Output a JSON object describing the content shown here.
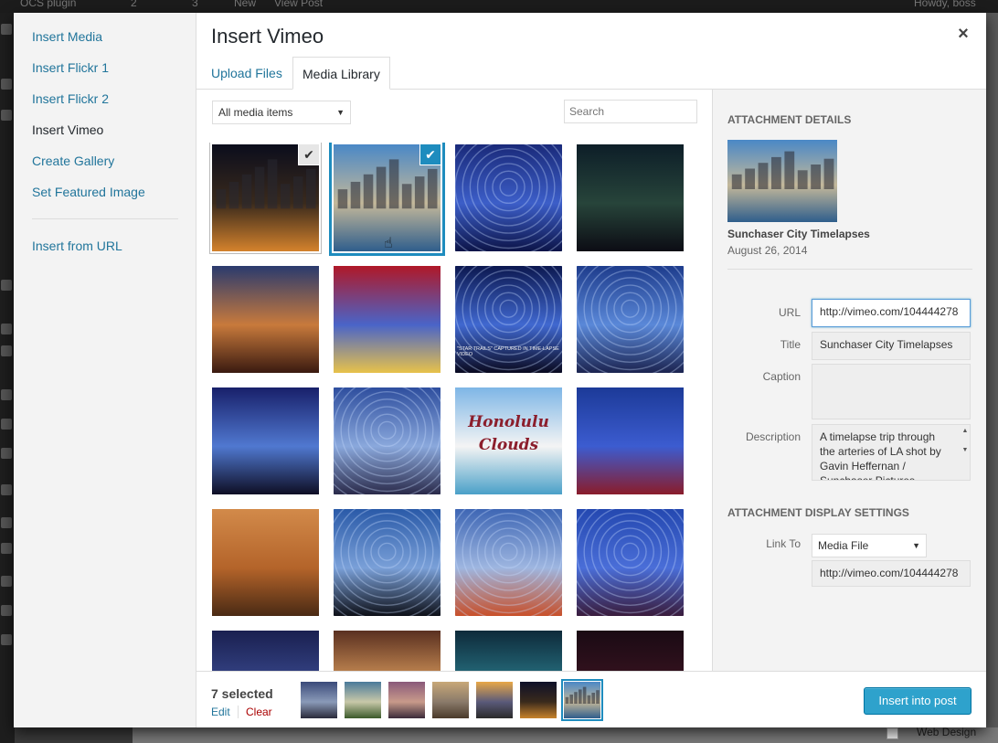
{
  "admin_bar": {
    "site": "OCS plugin",
    "updates": "2",
    "comments": "3",
    "new": "New",
    "view_post": "View Post",
    "howdy": "Howdy, boss"
  },
  "backdrop": {
    "category_label": "Web Design"
  },
  "menu": {
    "items": [
      {
        "label": "Insert Media"
      },
      {
        "label": "Insert Flickr 1"
      },
      {
        "label": "Insert Flickr 2"
      },
      {
        "label": "Insert Vimeo"
      },
      {
        "label": "Create Gallery"
      },
      {
        "label": "Set Featured Image"
      },
      {
        "label": "Insert from URL"
      }
    ],
    "active": "Insert Vimeo"
  },
  "modal": {
    "title": "Insert Vimeo",
    "close_icon": "×"
  },
  "tabs": [
    {
      "label": "Upload Files"
    },
    {
      "label": "Media Library"
    }
  ],
  "filters": {
    "type_selected": "All media items",
    "search_placeholder": "Search"
  },
  "thumbnails": [
    {
      "theme": "city night",
      "colors": [
        "#0b0d1c",
        "#3a2a1c",
        "#d4822c"
      ],
      "checked": true
    },
    {
      "theme": "city skyline",
      "colors": [
        "#4a88c6",
        "#c4b89a",
        "#2f5e8c"
      ],
      "checked": true,
      "focused": true
    },
    {
      "theme": "star trails",
      "colors": [
        "#1a2a7a",
        "#3c5ec8",
        "#0c1448"
      ]
    },
    {
      "theme": "canyon night",
      "colors": [
        "#0d1e28",
        "#27443a",
        "#0c0c14"
      ]
    },
    {
      "theme": "milky way desert",
      "colors": [
        "#2a3a6e",
        "#c87a3c",
        "#3a1a10"
      ]
    },
    {
      "theme": "lights",
      "colors": [
        "#b01828",
        "#4a64c8",
        "#e8c24a"
      ]
    },
    {
      "theme": "star trails video",
      "colors": [
        "#0c1850",
        "#4068d0",
        "#0a0a20"
      ],
      "caption": "\"STAR TRAILS\" CAPTURED IN TIME-LAPSE VIDEO"
    },
    {
      "theme": "circle trails",
      "colors": [
        "#1e3c8c",
        "#5a88d8",
        "#1c2450"
      ]
    },
    {
      "theme": "branches",
      "colors": [
        "#18206a",
        "#5078d0",
        "#0e0e24"
      ]
    },
    {
      "theme": "trails",
      "colors": [
        "#2e4e9e",
        "#8aa8dc",
        "#2a2a4a"
      ]
    },
    {
      "theme": "clouds",
      "colors": [
        "#7eb6e6",
        "#f4f4f4",
        "#4aa0c8"
      ],
      "text": "Honolulu Clouds"
    },
    {
      "theme": "dragon",
      "colors": [
        "#1c3a98",
        "#3c5cd0",
        "#8a1c2a"
      ]
    },
    {
      "theme": "beach",
      "colors": [
        "#d28a4a",
        "#b4642a",
        "#4a2a14"
      ]
    },
    {
      "theme": "car trails",
      "colors": [
        "#2a5aa8",
        "#7aa0d8",
        "#0e1018"
      ]
    },
    {
      "theme": "desert trails",
      "colors": [
        "#3e66b4",
        "#9eb6e0",
        "#c8502a"
      ]
    },
    {
      "theme": "person trails",
      "colors": [
        "#2448b0",
        "#4a6ed8",
        "#3a1c3c"
      ]
    },
    {
      "theme": "night sky",
      "colors": [
        "#1a2050",
        "#3a4a90",
        "#0e1030"
      ]
    },
    {
      "theme": "tunnel",
      "colors": [
        "#5a3020",
        "#e0a060",
        "#2a1a14"
      ]
    },
    {
      "theme": "aurora",
      "colors": [
        "#0e2a3a",
        "#2a7a8a",
        "#0a1420"
      ]
    },
    {
      "theme": "eclipse",
      "colors": [
        "#1a0a14",
        "#3a1420",
        "#7a2a3a"
      ]
    }
  ],
  "details": {
    "heading": "ATTACHMENT DETAILS",
    "filename": "Sunchaser City Timelapses",
    "date": "August 26, 2014",
    "url_label": "URL",
    "url_value": "http://vimeo.com/104444278",
    "title_label": "Title",
    "title_value": "Sunchaser City Timelapses",
    "caption_label": "Caption",
    "caption_value": "",
    "description_label": "Description",
    "description_value": "A timelapse trip through the arteries of LA shot by Gavin Heffernan / Sunchaser Pictures"
  },
  "display": {
    "heading": "ATTACHMENT DISPLAY SETTINGS",
    "link_to_label": "Link To",
    "link_to_value": "Media File",
    "link_url": "http://vimeo.com/104444278"
  },
  "selection": {
    "count_text": "7 selected",
    "edit": "Edit",
    "clear": "Clear",
    "minis": [
      {
        "colors": [
          "#3a4a7a",
          "#8a9ab8",
          "#2a2a3a"
        ]
      },
      {
        "colors": [
          "#4a7a9a",
          "#c8c8a8",
          "#3a5a2a"
        ]
      },
      {
        "colors": [
          "#8a5a7a",
          "#c89a8a",
          "#3a2a3a"
        ]
      },
      {
        "colors": [
          "#c8a878",
          "#8a7a6a",
          "#4a3a2a"
        ]
      },
      {
        "colors": [
          "#e8a848",
          "#5a5a7a",
          "#2a2a2a"
        ]
      },
      {
        "colors": [
          "#0e1028",
          "#3a2a1c",
          "#c8822a"
        ]
      },
      {
        "colors": [
          "#4a88c6",
          "#c4b89a",
          "#2f5e8c"
        ],
        "focused": true
      }
    ]
  },
  "insert_button": "Insert into post",
  "accent": "#1e8cbe",
  "button_color": "#2ea2cc"
}
